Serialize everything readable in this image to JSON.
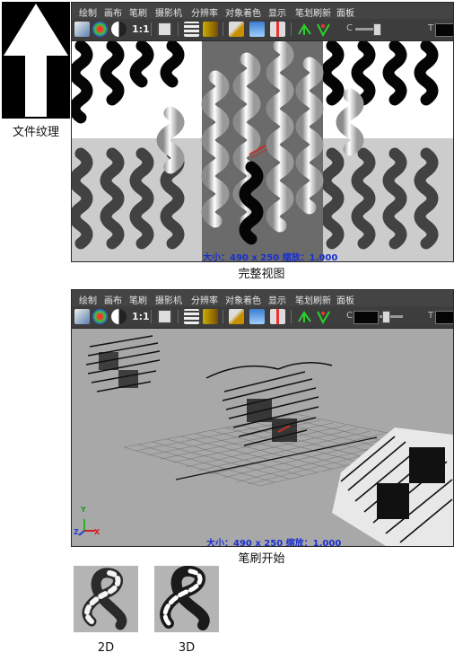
{
  "captions": {
    "file_texture": "文件纹理",
    "full_view": "完整视图",
    "stroke_start": "笔刷开始",
    "thumb_2d": "2D",
    "thumb_3d": "3D"
  },
  "menu": [
    "绘制",
    "画布",
    "笔刷",
    "摄影机",
    "分辨率",
    "对象着色",
    "显示",
    "笔划刷新",
    "面板"
  ],
  "toolbar": {
    "ratio_label": "1:1",
    "color_label": "C",
    "transparency_label": "T"
  },
  "panel_top": {
    "status": "大小：490 x 250  缩放：1.000"
  },
  "panel_bottom": {
    "status": "大小：490 x 250  缩放：1.000"
  },
  "axes": {
    "x": "X",
    "y": "Y",
    "z": "Z"
  },
  "colors": {
    "menubar": "#444444",
    "toolbar": "#3d3d3d",
    "status_text": "#1a2fd0",
    "ground": "#a8a8a8"
  }
}
